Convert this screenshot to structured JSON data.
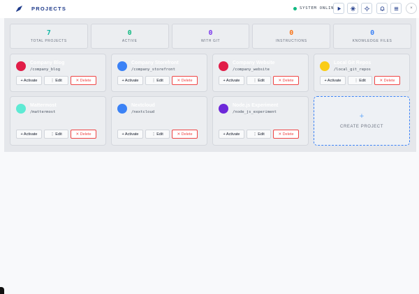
{
  "header": {
    "title": "PROJECTS",
    "status": "SYSTEM ONLINE",
    "logo_icon": "rocket-icon",
    "buttons": [
      {
        "name": "play-button",
        "icon": "play-icon"
      },
      {
        "name": "sparkle-button",
        "icon": "sparkle-icon"
      },
      {
        "name": "sun-button",
        "icon": "sun-icon"
      },
      {
        "name": "notifications-button",
        "icon": "bell-icon"
      },
      {
        "name": "menu-button",
        "icon": "menu-icon"
      }
    ],
    "round_button_icon": "x-icon",
    "round_button_label": "×"
  },
  "stats": [
    {
      "value": "7",
      "label": "TOTAL PROJECTS",
      "color": "#14b8a6"
    },
    {
      "value": "0",
      "label": "ACTIVE",
      "color": "#10b981"
    },
    {
      "value": "0",
      "label": "WITH GIT",
      "color": "#7c3aed"
    },
    {
      "value": "0",
      "label": "INSTRUCTIONS",
      "color": "#f97316"
    },
    {
      "value": "0",
      "label": "KNOWLEDGE FILES",
      "color": "#3b82f6"
    }
  ],
  "actions": {
    "activate": "+ Activate",
    "edit": "⋮ Edit",
    "delete": "✕ Delete"
  },
  "projects": [
    {
      "name": "Company Blog",
      "path": "/company_blog",
      "color": "#e11d48"
    },
    {
      "name": "Company Storefront",
      "path": "/company_storefront",
      "color": "#3b82f6"
    },
    {
      "name": "Company Website",
      "path": "/company_website",
      "color": "#e11d48"
    },
    {
      "name": "Local Git Repos",
      "path": "/local_git_repos",
      "color": "#facc15"
    },
    {
      "name": "Mattermost",
      "path": "/mattermost",
      "color": "#5eead4"
    },
    {
      "name": "Nextcloud",
      "path": "/nextcloud",
      "color": "#3b82f6"
    },
    {
      "name": "Node.js Experiment",
      "path": "/node_js_experiment",
      "color": "#6d28d9"
    }
  ],
  "create": {
    "plus": "+",
    "label": "CREATE PROJECT"
  }
}
